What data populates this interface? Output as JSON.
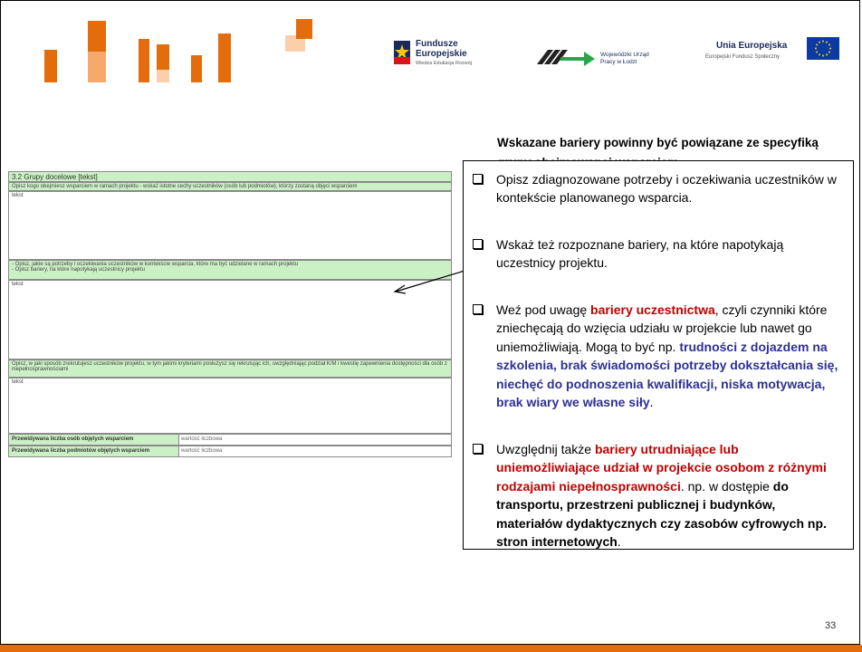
{
  "header": {
    "fe_logo": {
      "line1": "Fundusze",
      "line2": "Europejskie",
      "sub": "Wiedza Edukacja Rozwój"
    },
    "wup_logo": {
      "line1": "Wojewódzki Urząd",
      "line2": "Pracy w Łodzi"
    },
    "eu_logo": {
      "title": "Unia Europejska",
      "sub": "Europejski Fundusz Społeczny"
    }
  },
  "heading": "Wskazane bariery powinny być powiązane ze specyfiką grupy obejmowanej wsparciem",
  "form": {
    "title": "3.2 Grupy docelowe [tekst]",
    "q1": "Opisz kogo obejmiesz wsparciem w ramach projektu - wskaż istotne cechy uczestników (osób lub podmiotów), którzy zostaną objęci wsparciem",
    "a1": "tekst",
    "q2a": "- Opisz, jakie są potrzeby i oczekiwania uczestników w kontekście wsparcia, które ma być udzielane w ramach projektu",
    "q2b": "- Opisz bariery, na które napotykają uczestnicy projektu",
    "a2": "tekst",
    "q3": "Opisz, w jaki sposób zrekrutujesz uczestników projektu, w tym jakimi kryteriami posłużysz się rekrutując ich, uwzględniając podział K/M i kwestię zapewnienia dostępności dla osób z niepełnosprawnościami",
    "a3": "tekst",
    "row_persons_label": "Przewidywana liczba osób objętych wsparciem",
    "row_persons_value": "wartość liczbowa",
    "row_entities_label": "Przewidywana liczba podmiotów objętych wsparciem",
    "row_entities_value": "wartość liczbowa"
  },
  "bullets": {
    "b1": "Opisz zdiagnozowane potrzeby i oczekiwania uczestników w kontekście planowanego wsparcia.",
    "b2": "Wskaż też rozpoznane bariery, na które napotykają uczestnicy projektu.",
    "b3_pre": "Weź pod uwagę ",
    "b3_red": "bariery uczestnictwa",
    "b3_mid": ", czyli czynniki które zniechęcają do wzięcia udziału w projekcie lub nawet go uniemożliwiają. Mogą to być np. ",
    "b3_blue": "trudności z dojazdem na szkolenia, brak świadomości potrzeby dokształcania się, niechęć do podnoszenia kwalifikacji, niska motywacja, brak wiary we własne siły",
    "b3_end": ".",
    "b4_pre": "Uwzględnij także ",
    "b4_red": "bariery utrudniające lub uniemożliwiające udział w projekcie osobom z różnymi rodzajami niepełnosprawności",
    "b4_mid": ". np. w dostępie ",
    "b4_bold": "do transportu, przestrzeni publicznej i budynków, materiałów dydaktycznych czy zasobów cyfrowych np. stron internetowych",
    "b4_end": "."
  },
  "page_number": "33",
  "colors": {
    "accent_red": "#c00000",
    "accent_blue": "#2e3192",
    "form_green": "#ccf0c6",
    "bottom_bar": "#e46c0a"
  }
}
